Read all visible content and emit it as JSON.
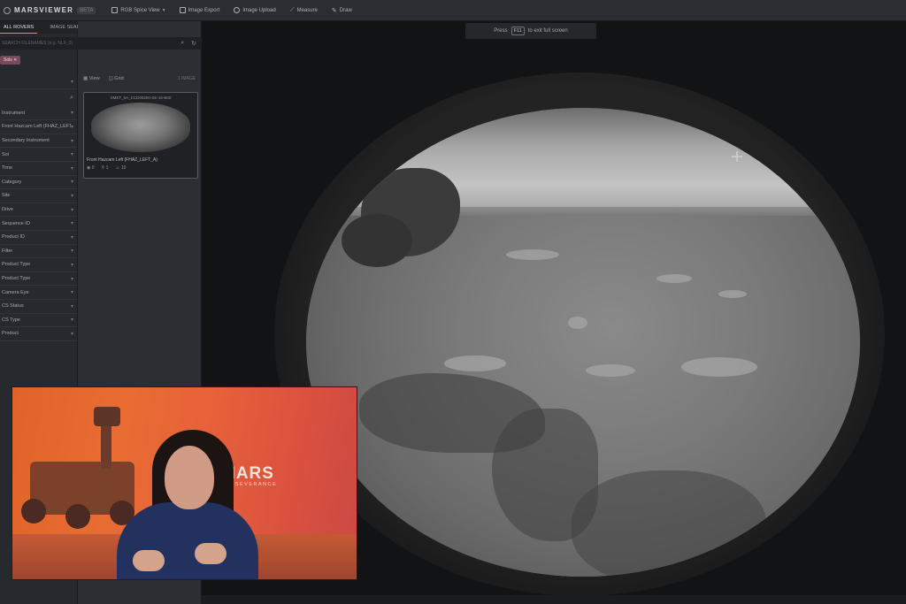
{
  "app": {
    "logo_text": "MARSVIEWER",
    "version": "BETA"
  },
  "toolbar": {
    "items": [
      {
        "label": "RGB Spice View",
        "icon": "layers-icon",
        "has_caret": true
      },
      {
        "label": "Image Export",
        "icon": "export-icon",
        "has_caret": false
      },
      {
        "label": "Image Upload",
        "icon": "upload-icon",
        "has_caret": false
      },
      {
        "label": "Measure",
        "icon": "ruler-icon",
        "has_caret": false
      },
      {
        "label": "Draw",
        "icon": "pencil-icon",
        "has_caret": false
      }
    ]
  },
  "sidebar": {
    "tabs": [
      "ALL ROVERS",
      "IMAGE SEARCH"
    ],
    "search_placeholder": "SEARCH FILENAMES (e.g. NLF_0)",
    "active_filter": "Sols",
    "rows": [
      "Instrument",
      "Front Hazcam Left (FHAZ_LEFT_A)",
      "Secondary Instrument",
      "Sol",
      "Time",
      "Category",
      "Site",
      "Drive",
      "Sequence ID",
      "Product ID",
      "Filter",
      "Product Type",
      "Product Type",
      "Camera Eye",
      "CS Status",
      "CS Type",
      "Product"
    ]
  },
  "browser": {
    "view_tabs": [
      "View",
      "Grid"
    ],
    "count_label": "1 IMAGE",
    "thumbnail": {
      "header": "SMET_0A_CCD00200-SE-16-B00",
      "title": "Front Hazcam Left (FHAZ_LEFT_A)",
      "stat_views": "0",
      "stat_pins": "1",
      "stat_users": "10"
    }
  },
  "viewer": {
    "fullscreen_hint_pre": "Press",
    "fullscreen_key": "F11",
    "fullscreen_hint_post": "to exit full screen"
  },
  "video": {
    "logo_text": "MARS",
    "logo_sub": "PERSEVERANCE"
  },
  "colors": {
    "toolbar_bg": "#2a2d31",
    "sidebar_bg": "#26292d",
    "filter_pill": "#7b4a5a",
    "video_bg": "#e0632a",
    "shirt": "#22315e"
  }
}
